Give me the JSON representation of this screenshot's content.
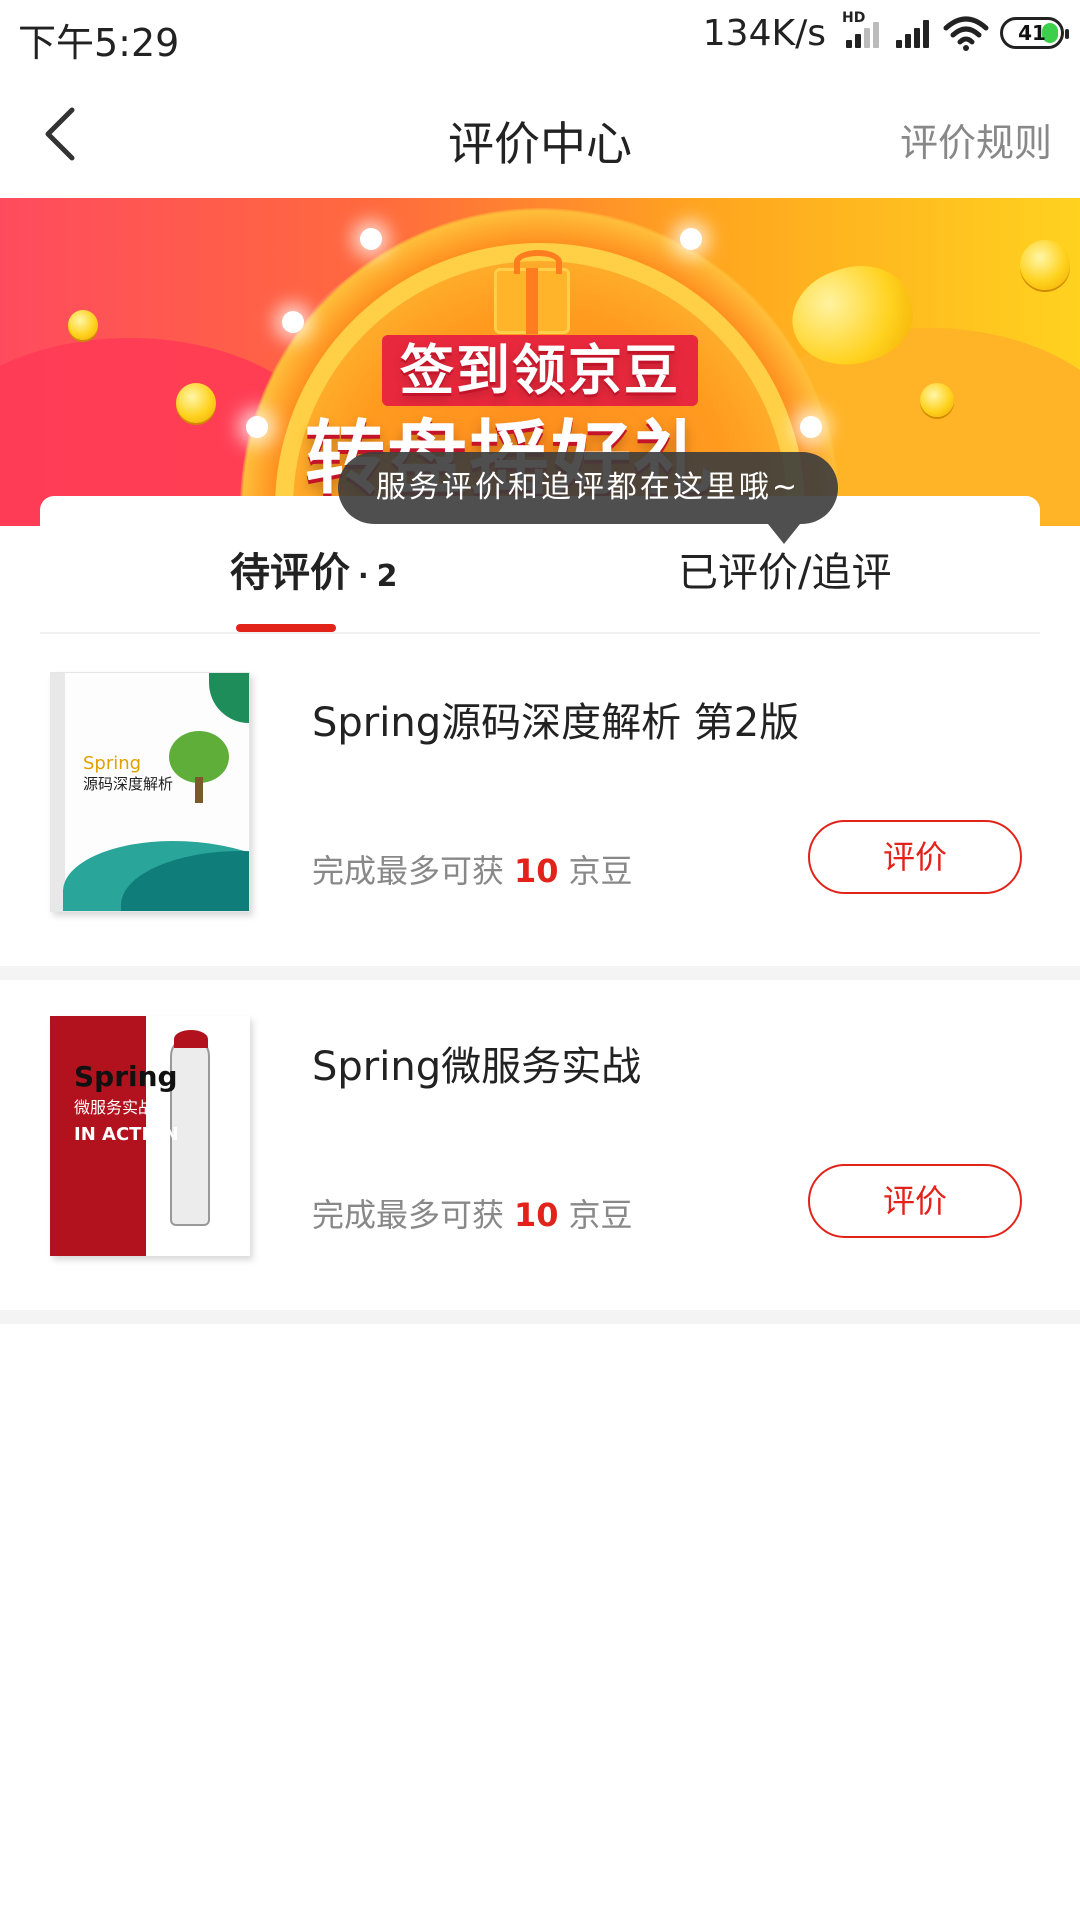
{
  "status_bar": {
    "time": "下午5:29",
    "net_speed": "134K/s",
    "hd_label": "HD",
    "battery": "41"
  },
  "nav": {
    "title": "评价中心",
    "rules": "评价规则"
  },
  "banner": {
    "title": "签到领京豆",
    "subtitle": "转盘摇好礼"
  },
  "tooltip": "服务评价和追评都在这里哦~",
  "tabs": {
    "pending_label": "待评价",
    "pending_count": "2",
    "done_label": "已评价/追评"
  },
  "products": [
    {
      "title": "Spring源码深度解析 第2版",
      "reward_prefix": "完成最多可获",
      "reward_beans": "10",
      "reward_suffix": "京豆",
      "button": "评价",
      "cover_text": "Spring",
      "cover_subtext": "源码深度解析"
    },
    {
      "title": "Spring微服务实战",
      "reward_prefix": "完成最多可获",
      "reward_beans": "10",
      "reward_suffix": "京豆",
      "button": "评价",
      "cover_text": "Spring",
      "cover_subtext": "微服务实战",
      "cover_subtext2": "IN ACTION"
    }
  ],
  "colors": {
    "accent": "#e2231a",
    "muted": "#888888"
  }
}
